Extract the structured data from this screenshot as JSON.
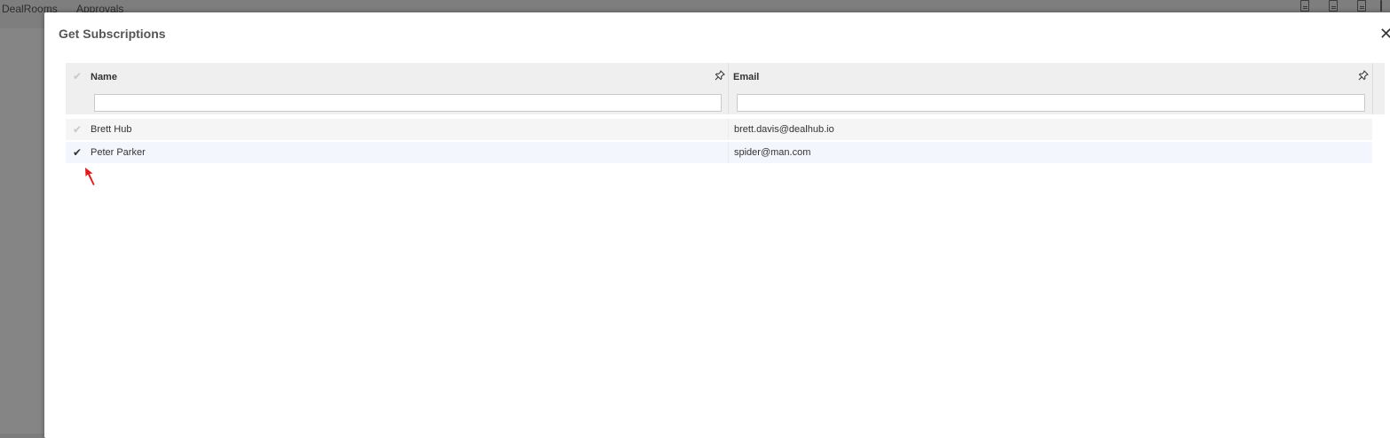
{
  "background_app": {
    "tabs": [
      "DealRooms",
      "Approvals"
    ]
  },
  "dialog": {
    "title": "Get Subscriptions",
    "close_glyph": "✕"
  },
  "grid": {
    "columns": [
      {
        "label": "Name",
        "filter_value": "",
        "pin_icon": "pin-icon"
      },
      {
        "label": "Email",
        "filter_value": "",
        "pin_icon": "pin-icon"
      }
    ],
    "select_all_glyph": "✔",
    "rows": [
      {
        "name": "Brett Hub",
        "email": "brett.davis@dealhub.io",
        "selected": false,
        "check_glyph": "✔"
      },
      {
        "name": "Peter Parker",
        "email": "spider@man.com",
        "selected": true,
        "check_glyph": "✔"
      }
    ]
  },
  "colors": {
    "overlay": "#7d7d7d",
    "modal": "#ffffff",
    "header_bg": "#efefef",
    "selected_row_bg": "#f4f6fd",
    "pointer": "#e31b1b"
  },
  "annotation": {
    "icon": "red-arrow-pointer-icon"
  }
}
